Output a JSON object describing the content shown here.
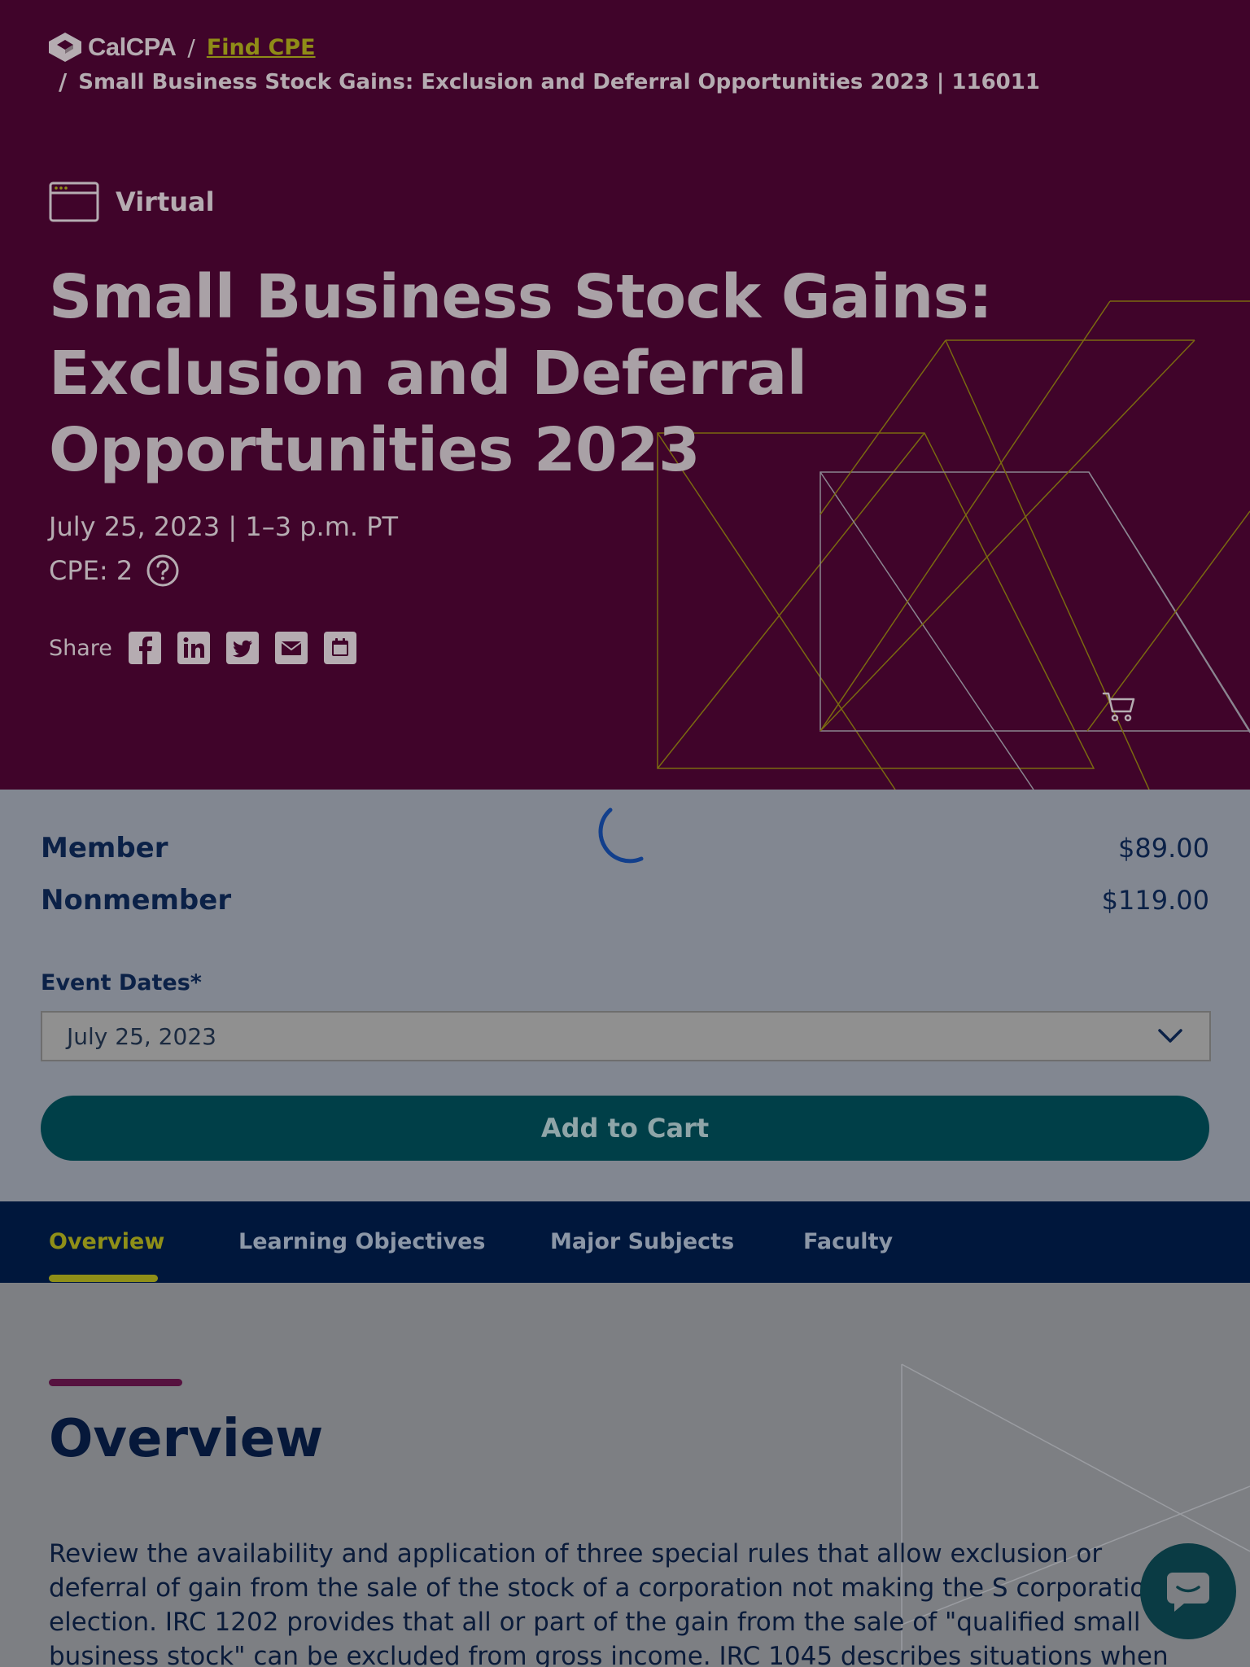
{
  "breadcrumb": {
    "logo_text": "CalCPA",
    "separator": "/",
    "link_label": "Find CPE",
    "current": "Small Business Stock Gains: Exclusion and Deferral Opportunities 2023 | 116011"
  },
  "event": {
    "format": "Virtual",
    "title": "Small Business Stock Gains: Exclusion and Deferral Opportunities 2023",
    "date_time": "July 25, 2023 | 1–3 p.m. PT",
    "cpe": "CPE: 2"
  },
  "share": {
    "label": "Share",
    "icons": [
      "facebook-icon",
      "linkedin-icon",
      "twitter-icon",
      "email-icon",
      "calendar-icon"
    ]
  },
  "pricing": {
    "member_label": "Member",
    "member_price": "$89.00",
    "nonmember_label": "Nonmember",
    "nonmember_price": "$119.00"
  },
  "event_dates": {
    "label": "Event Dates*",
    "selected": "July 25, 2023"
  },
  "add_to_cart_label": "Add to Cart",
  "tabs": [
    {
      "label": "Overview",
      "active": true
    },
    {
      "label": "Learning Objectives",
      "active": false
    },
    {
      "label": "Major Subjects",
      "active": false
    },
    {
      "label": "Faculty",
      "active": false
    }
  ],
  "overview": {
    "heading": "Overview",
    "text": "Review the availability and application of three special rules that allow exclusion or deferral of gain from the sale of the stock of a corporation not making the S corporation election. IRC 1202 provides that all or part of the gain from the sale of \"qualified small business stock\" can be excluded from gross income. IRC 1045 describes situations when"
  },
  "colors": {
    "hero_bg": "#40042a",
    "accent_lime": "#8f8f18",
    "navy": "#00173c",
    "teal_button": "#003f48",
    "overview_accent": "#56123f"
  }
}
